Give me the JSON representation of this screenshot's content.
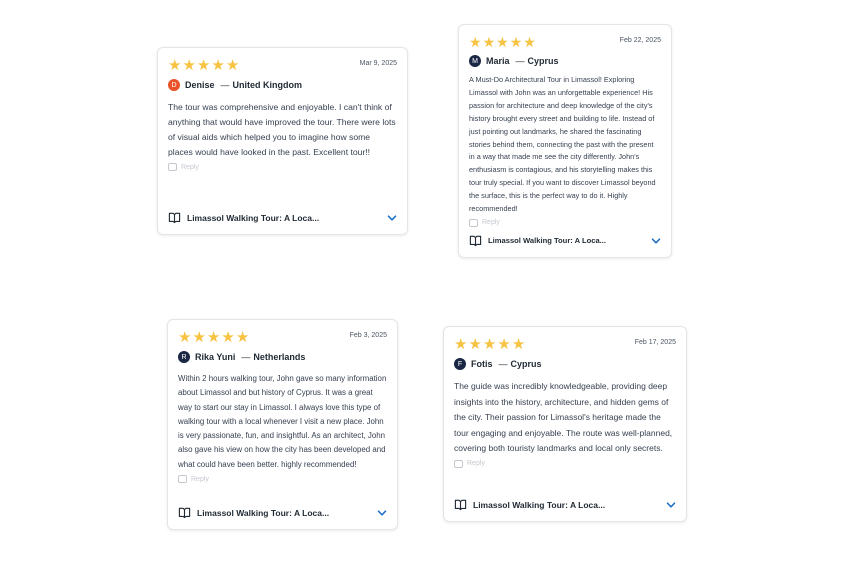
{
  "colors": {
    "star": "#f6c343",
    "chevron": "#1d6fc4"
  },
  "reviews": [
    {
      "rating": 5,
      "date": "Mar 9, 2025",
      "initial": "D",
      "avatar_color": "#e8532a",
      "name": "Denise",
      "country": "United Kingdom",
      "text": "The tour was comprehensive and enjoyable. I can't think of anything that would have improved the tour. There were lots of visual aids which helped you to imagine how some places would have looked in the past. Excellent tour!!",
      "reply_label": "Reply",
      "product": "Limassol Walking Tour: A Loca..."
    },
    {
      "rating": 5,
      "date": "Feb 22, 2025",
      "initial": "M",
      "avatar_color": "#1a2744",
      "name": "Maria",
      "country": "Cyprus",
      "text": "A Must-Do Architectural Tour in Limassol! Exploring Limassol with John was an unforgettable experience! His passion for architecture and deep knowledge of the city's history brought every street and building to life. Instead of just pointing out landmarks, he shared the fascinating stories behind them, connecting the past with the present in a way that made me see the city differently. John's enthusiasm is contagious, and his storytelling makes this tour truly special. If you want to discover Limassol beyond the surface, this is the perfect way to do it. Highly recommended!",
      "reply_label": "Reply",
      "product": "Limassol Walking Tour: A Loca..."
    },
    {
      "rating": 5,
      "date": "Feb 3, 2025",
      "initial": "R",
      "avatar_color": "#1a2744",
      "name": "Rika Yuni",
      "country": "Netherlands",
      "text": "Within 2 hours walking tour, John gave so many information about Limassol and but history of Cyprus. It was a great way to start our stay in Limassol. I always love this type of walking tour with a local whenever I visit a new place. John is very passionate, fun, and insightful. As an architect, John also gave his view on how the city has been developed and what could have been better. highly recommended!",
      "reply_label": "Reply",
      "product": "Limassol Walking Tour: A Loca..."
    },
    {
      "rating": 5,
      "date": "Feb 17, 2025",
      "initial": "F",
      "avatar_color": "#1a2744",
      "name": "Fotis",
      "country": "Cyprus",
      "text": "The guide was incredibly knowledgeable, providing deep insights into the history, architecture, and hidden gems of the city. Their passion for Limassol's heritage made the tour engaging and enjoyable. The route was well-planned, covering both touristy landmarks and local only secrets.",
      "reply_label": "Reply",
      "product": "Limassol Walking Tour: A Loca..."
    }
  ]
}
